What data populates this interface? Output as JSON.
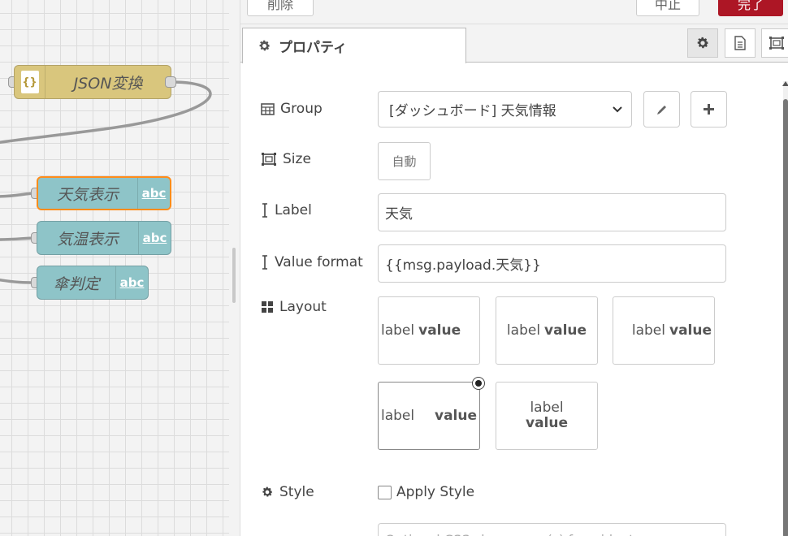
{
  "canvas": {
    "nodes": [
      {
        "label": "JSON変換",
        "type": "json"
      },
      {
        "label": "天気表示",
        "type": "text",
        "badge": "abc",
        "selected": true
      },
      {
        "label": "気温表示",
        "type": "text",
        "badge": "abc"
      },
      {
        "label": "傘判定",
        "type": "text",
        "badge": "abc"
      }
    ],
    "json_icon_text": "{}"
  },
  "tray": {
    "header": {
      "delete_label": "削除",
      "cancel_label": "中止",
      "done_label": "完了"
    },
    "tabs": {
      "properties_label": "プロパティ"
    },
    "form": {
      "group_label": "Group",
      "group_value": "[ダッシュボード] 天気情報",
      "size_label": "Size",
      "size_value": "自動",
      "label_label": "Label",
      "label_value": "天気",
      "format_label": "Value format",
      "format_value": "{{msg.payload.天気}}",
      "layout_label": "Layout",
      "layout_options": [
        {
          "label": "label",
          "value": "value"
        },
        {
          "label": "label",
          "value": "value"
        },
        {
          "label": "label",
          "value": "value"
        },
        {
          "label": "label",
          "value": "value"
        },
        {
          "label": "label",
          "value": "value"
        }
      ],
      "style_label": "Style",
      "apply_style_label": "Apply Style",
      "class_placeholder": "Optional CSS class name(s) for widget"
    }
  },
  "colors": {
    "done_button": "#ad1625",
    "json_node": "#d9c67d",
    "text_node": "#8ec4c8",
    "selected_border": "#ff8c1a"
  }
}
